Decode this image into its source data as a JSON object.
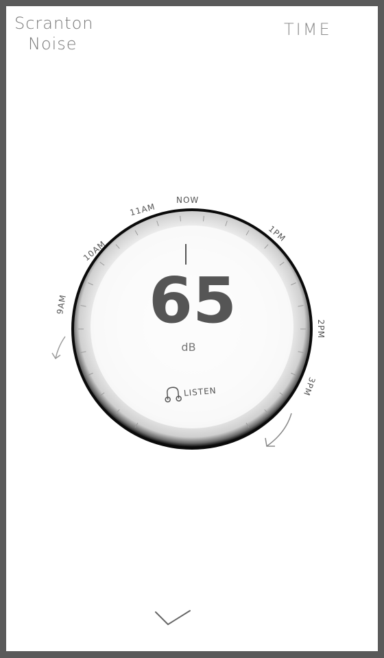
{
  "header": {
    "title_line1": "Scranton",
    "title_line2": "Noise",
    "time_label": "TIME"
  },
  "dial": {
    "value": "65",
    "unit": "dB",
    "ticks": [
      "9AM",
      "10AM",
      "11AM",
      "NOW",
      "1PM",
      "2PM",
      "3PM"
    ],
    "listen_label": "LISTEN"
  },
  "icons": {
    "listen": "headphones-icon",
    "back": "arrow-left-icon",
    "forward": "arrow-curve-icon",
    "confirm": "checkmark-icon"
  },
  "colors": {
    "frame": "#5a5a5a",
    "ring": "#0a0a0a",
    "text": "#555555"
  }
}
